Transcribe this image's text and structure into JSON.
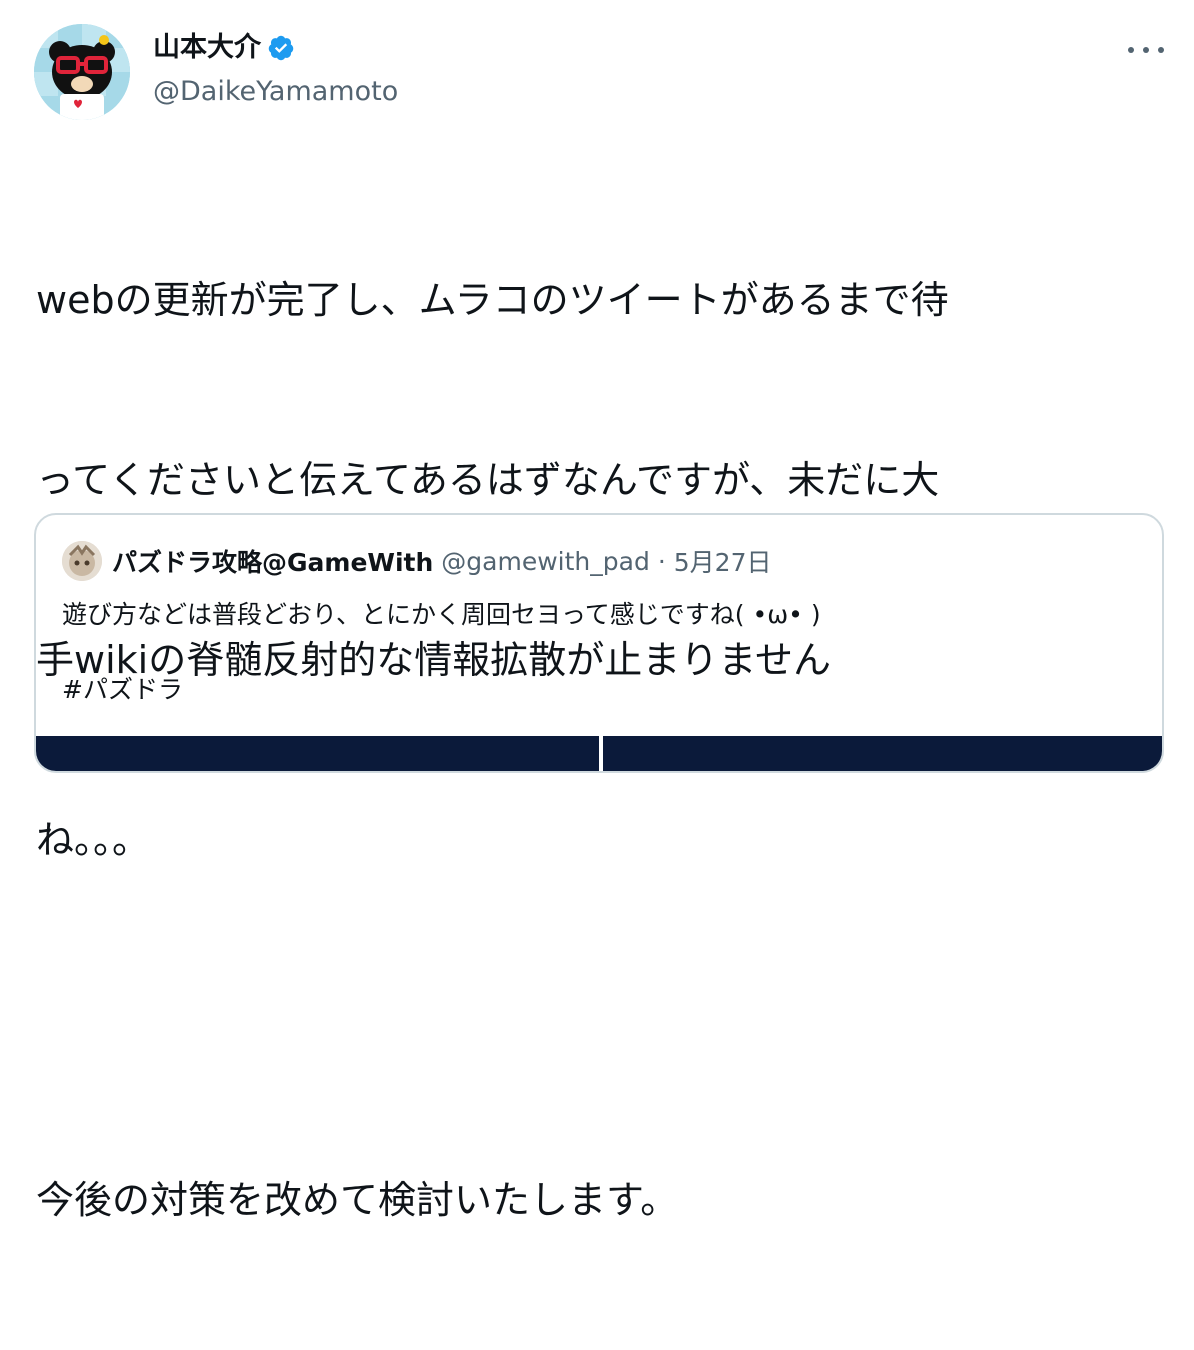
{
  "tweet": {
    "display_name": "山本大介",
    "handle": "@DaikeYamamoto",
    "lines": [
      "webの更新が完了し、ムラコのツイートがあるまで待",
      "ってくださいと伝えてあるはずなんですが、未だに大",
      "手wikiの脊髄反射的な情報拡散が止まりません",
      "ね。。。"
    ],
    "line_after_gap": "今後の対策を改めて検討いたします。",
    "verified_color": "#1d9bf0"
  },
  "quote": {
    "display_name": "パズドラ攻略@GameWith",
    "handle": "@gamewith_pad",
    "separator": "·",
    "date": "5月27日",
    "text": "遊び方などは普段どおり、とにかく周回セヨって感じですね(  •ω• )",
    "hashtag": "#パズドラ"
  }
}
